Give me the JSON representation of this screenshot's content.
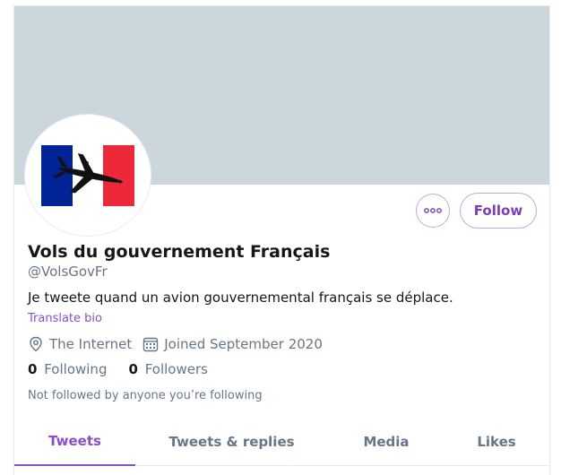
{
  "profile": {
    "display_name": "Vols du gouvernement Français",
    "handle": "@VolsGovFr",
    "bio": "Je tweete quand un avion gouvernemental français se déplace.",
    "translate_label": "Translate bio",
    "location": "The Internet",
    "joined": "Joined September 2020",
    "not_followed": "Not followed by anyone you’re following"
  },
  "stats": {
    "following_count": "0",
    "following_label": "Following",
    "followers_count": "0",
    "followers_label": "Followers"
  },
  "actions": {
    "follow_label": "Follow",
    "more_icon": "more-horizontal-icon"
  },
  "tabs": [
    {
      "label": "Tweets",
      "active": true
    },
    {
      "label": "Tweets & replies",
      "active": false
    },
    {
      "label": "Media",
      "active": false
    },
    {
      "label": "Likes",
      "active": false
    }
  ],
  "colors": {
    "accent": "#8a4fc9",
    "banner": "#ccd6dd",
    "flag_blue": "#002395",
    "flag_white": "#ffffff",
    "flag_red": "#ed2939"
  }
}
